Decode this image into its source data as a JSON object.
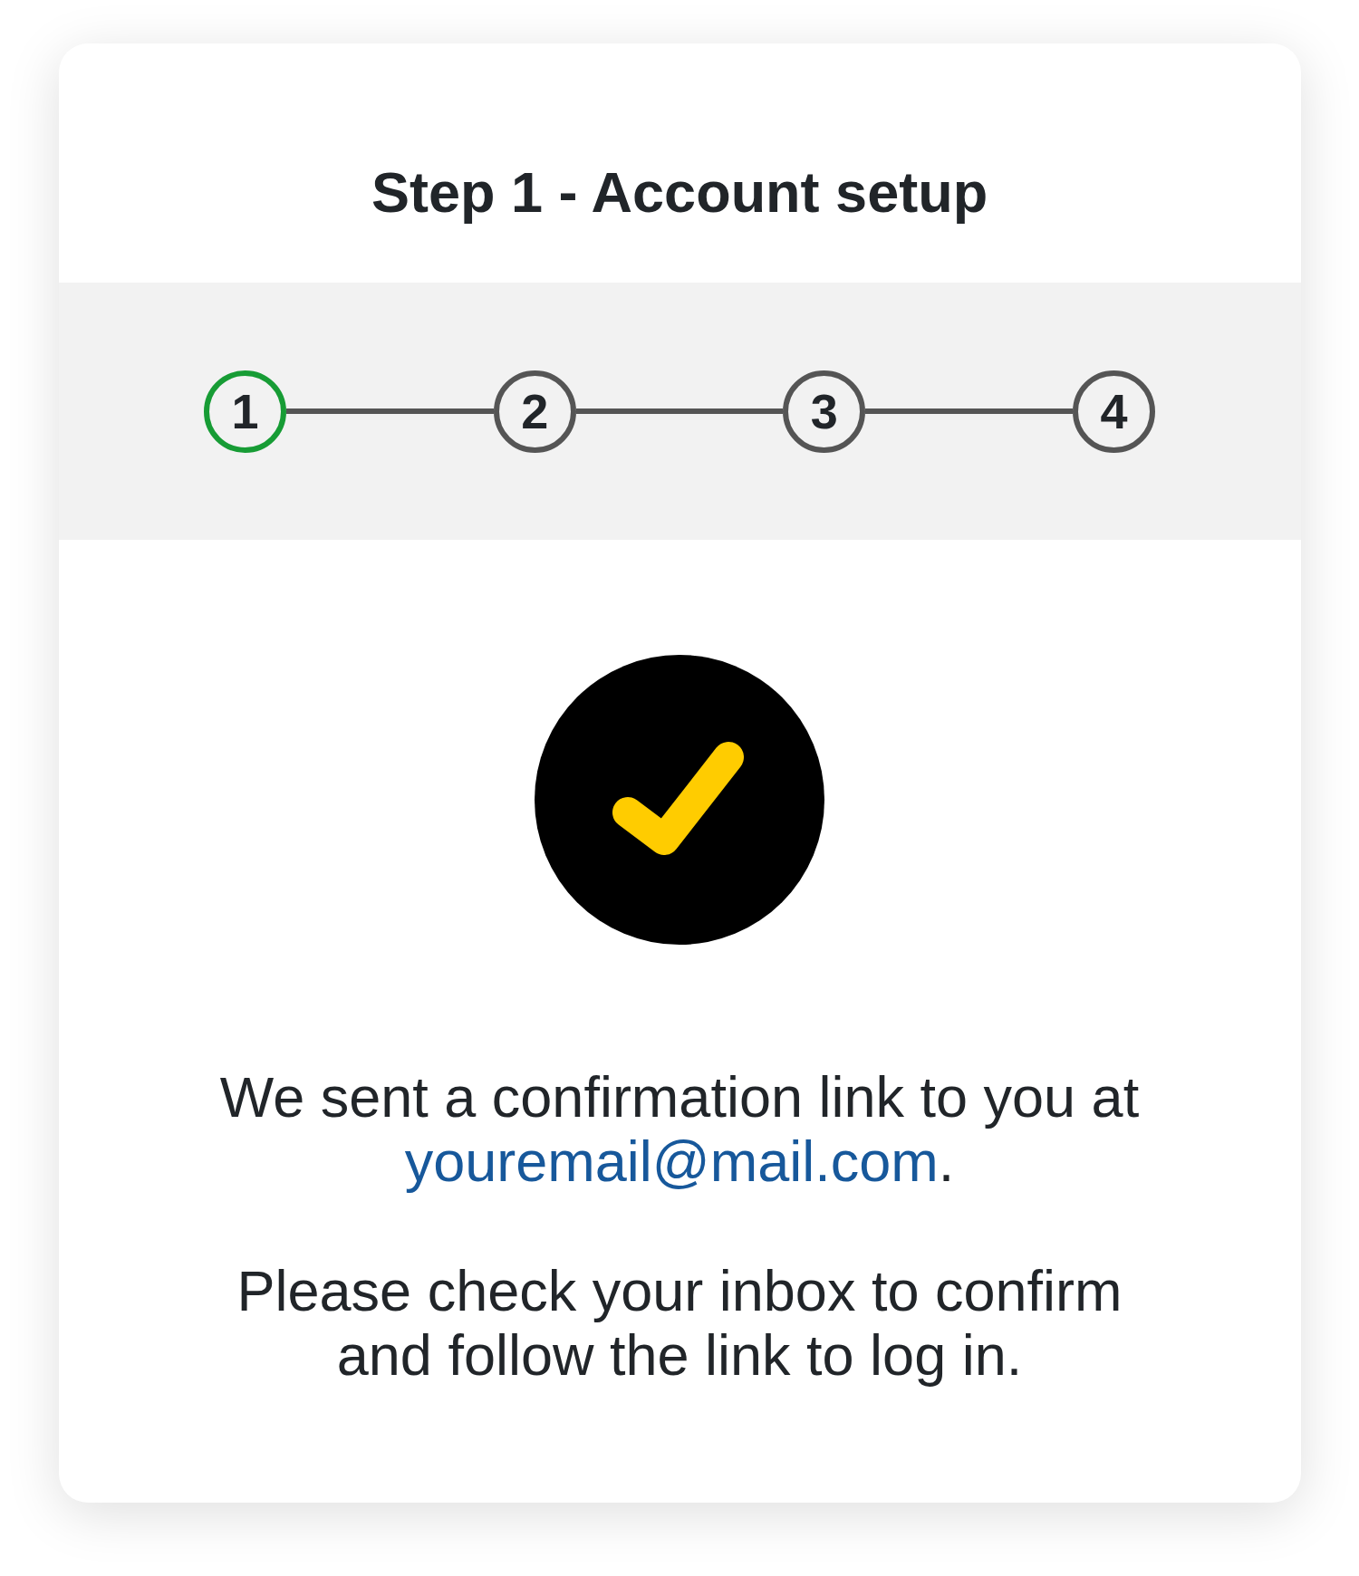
{
  "title": "Step 1 - Account setup",
  "steps": [
    {
      "label": "1",
      "current": true
    },
    {
      "label": "2",
      "current": false
    },
    {
      "label": "3",
      "current": false
    },
    {
      "label": "4",
      "current": false
    }
  ],
  "confirmation": {
    "text_before": "We sent a confirmation link to you at",
    "email_link": "youremail@mail.com",
    "text_after": "."
  },
  "instructions": "Please check your inbox to confirm and follow the link to log in."
}
